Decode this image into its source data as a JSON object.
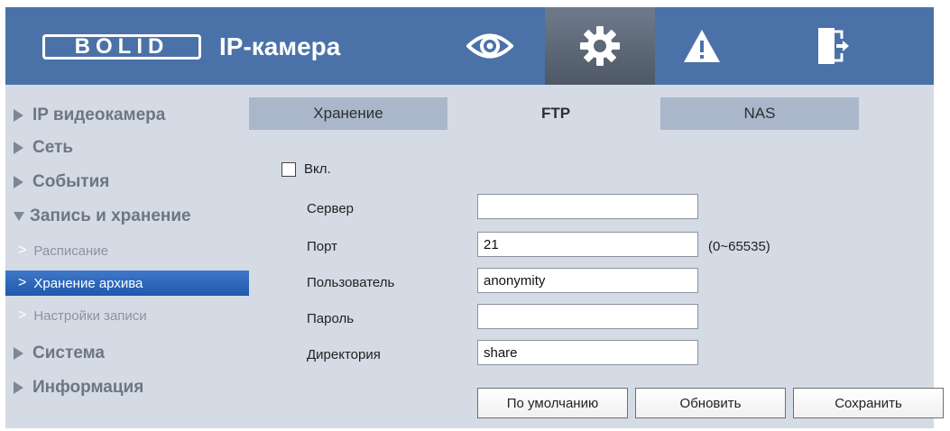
{
  "header": {
    "logo": "BOLID",
    "title": "IP-камера",
    "nav": [
      {
        "icon": "eye-icon"
      },
      {
        "icon": "gear-icon",
        "active": true
      },
      {
        "icon": "warning-icon"
      },
      {
        "icon": "exit-icon"
      }
    ]
  },
  "sidebar": {
    "items": [
      {
        "label": "IP видеокамера"
      },
      {
        "label": "Сеть"
      },
      {
        "label": "События"
      },
      {
        "label": "Запись и хранение",
        "expanded": true
      },
      {
        "label": "Система"
      },
      {
        "label": "Информация"
      }
    ],
    "subitems": [
      {
        "label": "Расписание"
      },
      {
        "label": "Хранение архива",
        "active": true
      },
      {
        "label": "Настройки записи"
      }
    ]
  },
  "tabs": [
    {
      "label": "Хранение"
    },
    {
      "label": "FTP",
      "active": true
    },
    {
      "label": "NAS"
    }
  ],
  "form": {
    "enable_label": "Вкл.",
    "enabled": false,
    "server_label": "Сервер",
    "server_value": "",
    "port_label": "Порт",
    "port_value": "21",
    "port_hint": "(0~65535)",
    "user_label": "Пользователь",
    "user_value": "anonymity",
    "password_label": "Пароль",
    "password_value": "",
    "dir_label": "Директория",
    "dir_value": "share"
  },
  "buttons": {
    "default": "По умолчанию",
    "refresh": "Обновить",
    "save": "Сохранить"
  },
  "colors": {
    "header": "#4a72a8",
    "active_nav": "#5e6978",
    "active_subitem": "#2a64b8",
    "panel": "#d4dbe5",
    "tab_inactive": "#aab7ca"
  }
}
